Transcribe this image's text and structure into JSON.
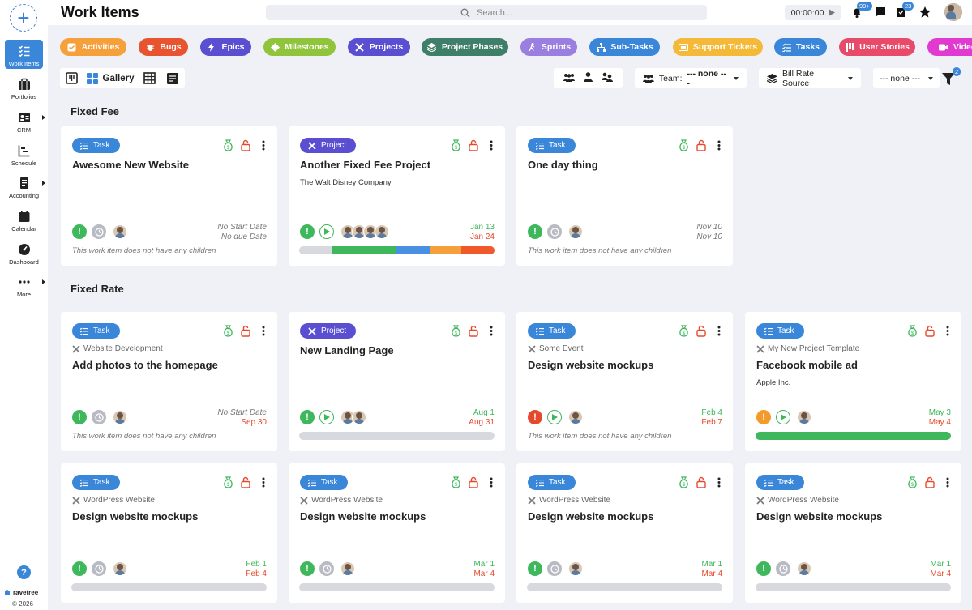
{
  "app": {
    "title": "Work Items",
    "search_placeholder": "Search...",
    "timer": "00:00:00",
    "notifications_badge": "99+",
    "tasks_badge": "23",
    "brand": "ravetree",
    "copyright": "© 2026",
    "add_label": "+",
    "help_label": "?"
  },
  "sidebar": {
    "items": [
      {
        "label": "Work Items",
        "icon": "checklist-icon",
        "active": true
      },
      {
        "label": "Portfolios",
        "icon": "briefcase-icon"
      },
      {
        "label": "CRM",
        "icon": "contact-card-icon",
        "submenu": true
      },
      {
        "label": "Schedule",
        "icon": "schedule-chart-icon"
      },
      {
        "label": "Accounting",
        "icon": "ledger-icon",
        "submenu": true
      },
      {
        "label": "Calendar",
        "icon": "calendar-icon"
      },
      {
        "label": "Dashboard",
        "icon": "gauge-icon"
      },
      {
        "label": "More",
        "icon": "more-dots-icon",
        "submenu": true
      }
    ]
  },
  "categories": [
    {
      "label": "Activities",
      "color": "#f5a03a",
      "icon": "checkbox-icon"
    },
    {
      "label": "Bugs",
      "color": "#e8542f",
      "icon": "bug-icon"
    },
    {
      "label": "Epics",
      "color": "#5b4fd1",
      "icon": "bolt-icon"
    },
    {
      "label": "Milestones",
      "color": "#8fc43c",
      "icon": "diamond-icon"
    },
    {
      "label": "Projects",
      "color": "#5b4fd1",
      "icon": "tools-icon"
    },
    {
      "label": "Project Phases",
      "color": "#3f7f6a",
      "icon": "layers-icon"
    },
    {
      "label": "Sprints",
      "color": "#9a7fe0",
      "icon": "runner-icon"
    },
    {
      "label": "Sub-Tasks",
      "color": "#3a86d9",
      "icon": "hierarchy-icon"
    },
    {
      "label": "Support Tickets",
      "color": "#f5b93a",
      "icon": "ticket-icon"
    },
    {
      "label": "Tasks",
      "color": "#3a86d9",
      "icon": "list-check-icon"
    },
    {
      "label": "User Stories",
      "color": "#e84a6a",
      "icon": "columns-icon"
    },
    {
      "label": "Videos",
      "color": "#e03ad1",
      "icon": "video-icon"
    }
  ],
  "toolbar": {
    "view_label": "Gallery",
    "team_label": "Team:",
    "team_value": "--- none ---",
    "bill_rate_label": "Bill Rate Source",
    "filter_value": "--- none ---",
    "filter_badge": "2"
  },
  "groups": [
    {
      "title": "Fixed Fee"
    },
    {
      "title": "Fixed Rate"
    }
  ],
  "cards": [
    {
      "type": "Task",
      "title": "Awesome New Website",
      "parent": "",
      "subtitle": "",
      "status": "green",
      "timer": "clock",
      "start": "No Start Date",
      "due": "No due Date",
      "children_note": "This work item does not have any children"
    },
    {
      "type": "Project",
      "title": "Another Fixed Fee Project",
      "parent": "",
      "subtitle": "The Walt Disney Company",
      "status": "green",
      "timer": "play",
      "start": "Jan 13",
      "due": "Jan 24",
      "progress_segments": [
        {
          "pct": 17,
          "color": "#d7d9de"
        },
        {
          "pct": 33,
          "color": "#3fb75c"
        },
        {
          "pct": 17,
          "color": "#4a90e2"
        },
        {
          "pct": 16,
          "color": "#f5a03a"
        },
        {
          "pct": 17,
          "color": "#f05a2b"
        }
      ]
    },
    {
      "type": "Task",
      "title": "One day thing",
      "parent": "",
      "subtitle": "",
      "status": "green",
      "timer": "clock",
      "start": "Nov 10",
      "due": "Nov 10",
      "children_note": "This work item does not have any children"
    },
    {
      "type": "Task",
      "title": "Add photos to the homepage",
      "parent": "Website Development",
      "subtitle": "",
      "status": "green",
      "timer": "clock",
      "start": "No Start Date",
      "due": "Sep 30",
      "children_note": "This work item does not have any children"
    },
    {
      "type": "Project",
      "title": "New Landing Page",
      "parent": "",
      "subtitle": "",
      "status": "green",
      "timer": "play",
      "start": "Aug 1",
      "due": "Aug 31",
      "progress": 0
    },
    {
      "type": "Task",
      "title": "Design website mockups",
      "parent": "Some Event",
      "subtitle": "",
      "status": "red",
      "timer": "play",
      "start": "Feb 4",
      "due": "Feb 7",
      "children_note": "This work item does not have any children"
    },
    {
      "type": "Task",
      "title": "Facebook mobile ad",
      "parent": "My New Project Template",
      "subtitle": "Apple Inc.",
      "status": "orange",
      "timer": "play",
      "start": "May 3",
      "due": "May 4",
      "progress": 1.0
    },
    {
      "type": "Task",
      "title": "Design website mockups",
      "parent": "WordPress Website",
      "subtitle": "",
      "status": "green",
      "timer": "clock",
      "start": "Feb 1",
      "due": "Feb 4",
      "progress": 0
    },
    {
      "type": "Task",
      "title": "Design website mockups",
      "parent": "WordPress Website",
      "subtitle": "",
      "status": "green",
      "timer": "clock",
      "start": "Mar 1",
      "due": "Mar 4",
      "progress": 0
    },
    {
      "type": "Task",
      "title": "Design website mockups",
      "parent": "WordPress Website",
      "subtitle": "",
      "status": "green",
      "timer": "clock",
      "start": "Mar 1",
      "due": "Mar 4",
      "progress": 0
    },
    {
      "type": "Task",
      "title": "Design website mockups",
      "parent": "WordPress Website",
      "subtitle": "",
      "status": "green",
      "timer": "clock",
      "start": "Mar 1",
      "due": "Mar 4",
      "progress": 0
    }
  ]
}
